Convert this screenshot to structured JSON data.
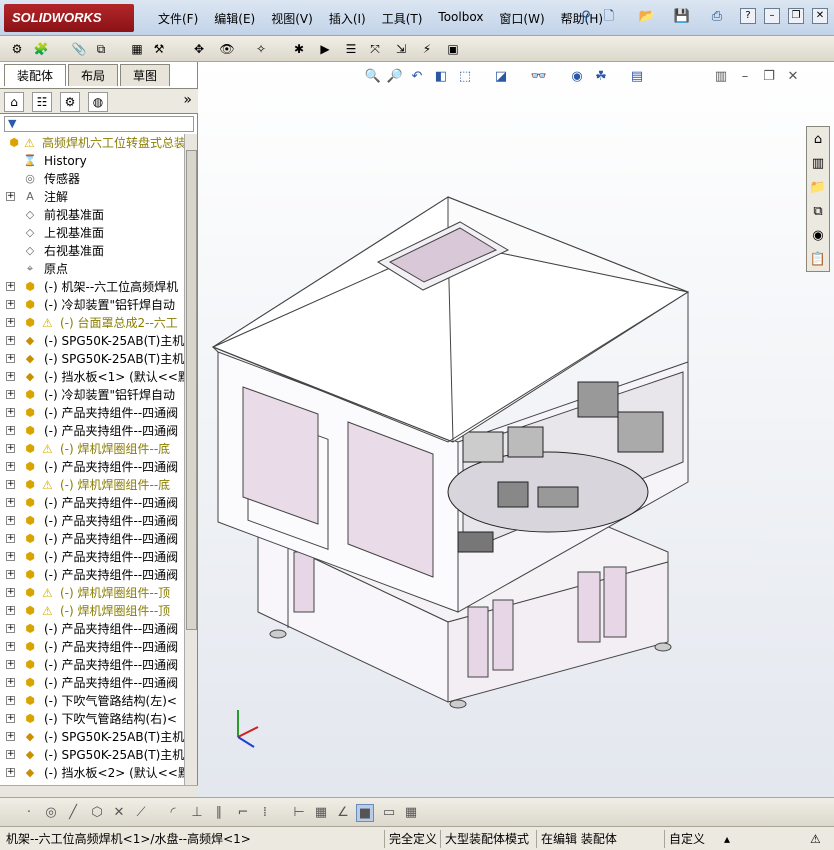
{
  "app": {
    "logo": "SOLIDWORKS"
  },
  "menu": [
    "文件(F)",
    "编辑(E)",
    "视图(V)",
    "插入(I)",
    "工具(T)",
    "Toolbox",
    "窗口(W)",
    "帮助(H)"
  ],
  "window_controls": {
    "help": "?",
    "minimize": "–",
    "restore": "❐",
    "close": "✕"
  },
  "tabs": [
    "装配体",
    "布局",
    "草图"
  ],
  "filter": {
    "icon": "funnel-icon"
  },
  "tree": [
    {
      "label": "高频焊机六工位转盘式总装",
      "icon": "assembly-icon",
      "warn": true,
      "top": true
    },
    {
      "label": "History",
      "icon": "history-icon"
    },
    {
      "label": "传感器",
      "icon": "sensor-icon"
    },
    {
      "label": "注解",
      "icon": "annotation-icon",
      "expand": true
    },
    {
      "label": "前视基准面",
      "icon": "plane-icon"
    },
    {
      "label": "上视基准面",
      "icon": "plane-icon"
    },
    {
      "label": "右视基准面",
      "icon": "plane-icon"
    },
    {
      "label": "原点",
      "icon": "origin-icon"
    },
    {
      "label": "(-) 机架--六工位高频焊机",
      "icon": "assembly-icon",
      "expand": true
    },
    {
      "label": "(-) 冷却装置\"铝钎焊自动",
      "icon": "assembly-icon",
      "expand": true
    },
    {
      "label": "(-) 台面罩总成2--六工",
      "icon": "assembly-icon",
      "expand": true,
      "warn": true
    },
    {
      "label": "(-) SPG50K-25AB(T)主机<",
      "icon": "part-icon",
      "expand": true
    },
    {
      "label": "(-) SPG50K-25AB(T)主机<",
      "icon": "part-icon",
      "expand": true
    },
    {
      "label": "(-) 挡水板<1> (默认<<默",
      "icon": "part-icon",
      "expand": true
    },
    {
      "label": "(-) 冷却装置\"铝钎焊自动",
      "icon": "assembly-icon",
      "expand": true
    },
    {
      "label": "(-) 产品夹持组件--四通阀",
      "icon": "assembly-icon",
      "expand": true
    },
    {
      "label": "(-) 产品夹持组件--四通阀",
      "icon": "assembly-icon",
      "expand": true
    },
    {
      "label": "(-) 焊机焊圈组件--底",
      "icon": "assembly-icon",
      "expand": true,
      "warn": true
    },
    {
      "label": "(-) 产品夹持组件--四通阀",
      "icon": "assembly-icon",
      "expand": true
    },
    {
      "label": "(-) 焊机焊圈组件--底",
      "icon": "assembly-icon",
      "expand": true,
      "warn": true
    },
    {
      "label": "(-) 产品夹持组件--四通阀",
      "icon": "assembly-icon",
      "expand": true
    },
    {
      "label": "(-) 产品夹持组件--四通阀",
      "icon": "assembly-icon",
      "expand": true
    },
    {
      "label": "(-) 产品夹持组件--四通阀",
      "icon": "assembly-icon",
      "expand": true
    },
    {
      "label": "(-) 产品夹持组件--四通阀",
      "icon": "assembly-icon",
      "expand": true
    },
    {
      "label": "(-) 产品夹持组件--四通阀",
      "icon": "assembly-icon",
      "expand": true
    },
    {
      "label": "(-) 焊机焊圈组件--顶",
      "icon": "assembly-icon",
      "expand": true,
      "warn": true
    },
    {
      "label": "(-) 焊机焊圈组件--顶",
      "icon": "assembly-icon",
      "expand": true,
      "warn": true
    },
    {
      "label": "(-) 产品夹持组件--四通阀",
      "icon": "assembly-icon",
      "expand": true
    },
    {
      "label": "(-) 产品夹持组件--四通阀",
      "icon": "assembly-icon",
      "expand": true
    },
    {
      "label": "(-) 产品夹持组件--四通阀",
      "icon": "assembly-icon",
      "expand": true
    },
    {
      "label": "(-) 产品夹持组件--四通阀",
      "icon": "assembly-icon",
      "expand": true
    },
    {
      "label": "(-) 下吹气管路结构(左)<",
      "icon": "assembly-icon",
      "expand": true
    },
    {
      "label": "(-) 下吹气管路结构(右)<",
      "icon": "assembly-icon",
      "expand": true
    },
    {
      "label": "(-) SPG50K-25AB(T)主机<",
      "icon": "part-icon",
      "expand": true
    },
    {
      "label": "(-) SPG50K-25AB(T)主机<",
      "icon": "part-icon",
      "expand": true
    },
    {
      "label": "(-) 挡水板<2> (默认<<默",
      "icon": "part-icon",
      "expand": true
    }
  ],
  "status": {
    "path": "机架--六工位高频焊机<1>/水盘--高频焊<1>",
    "defined": "完全定义",
    "mode": "大型装配体模式",
    "editing": "在编辑 装配体",
    "units": "自定义"
  }
}
